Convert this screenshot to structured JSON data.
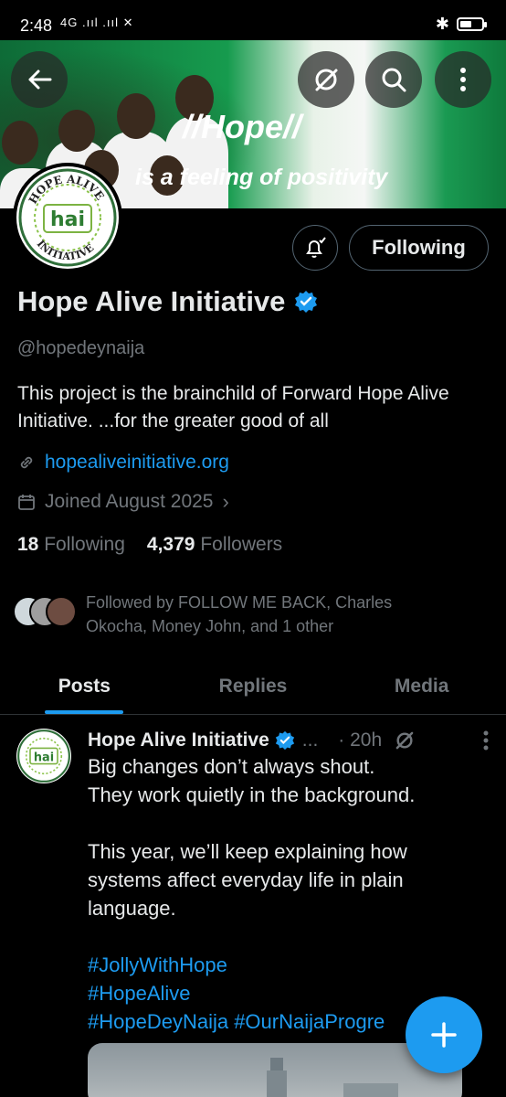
{
  "status_bar": {
    "time": "2:48",
    "network": "4G",
    "signal_text": ".ııl .ııl"
  },
  "banner": {
    "headline": "//Hope//",
    "tagline": "is a feeling of positivity"
  },
  "logo": {
    "top_text": "HOPE ALIVE",
    "mark": "hai",
    "bottom_text": "INITIATIVE"
  },
  "profile": {
    "following_button": "Following",
    "name": "Hope Alive Initiative",
    "handle": "@hopedeynaija",
    "bio": "This project is the brainchild of Forward Hope Alive Initiative. ...for the greater good of all",
    "website": "hopealiveinitiative.org",
    "joined": "Joined August 2025",
    "following_count": "18",
    "following_label": "Following",
    "followers_count": "4,379",
    "followers_label": "Followers",
    "followed_by": "Followed by FOLLOW ME BACK, Charles Okocha, Money John, and 1 other"
  },
  "tabs": [
    {
      "label": "Posts",
      "active": true
    },
    {
      "label": "Replies",
      "active": false
    },
    {
      "label": "Media",
      "active": false
    }
  ],
  "post": {
    "author": "Hope Alive Initiative",
    "ellipsis": "...",
    "time": "· 20h",
    "line1": "Big changes don’t always shout.",
    "line2": "They work quietly in the background.",
    "line3": "This year, we’ll keep explaining how",
    "line4": "systems affect everyday life in plain",
    "line5": "language.",
    "hashtag1": "#JollyWithHope",
    "hashtag2": "#HopeAlive",
    "hashtag3": "#HopeDeyNaija #OurNaijaProgre"
  },
  "colors": {
    "accent": "#1d9bf0",
    "muted": "#71767b",
    "background": "#000000",
    "flag_green": "#169b4e"
  }
}
